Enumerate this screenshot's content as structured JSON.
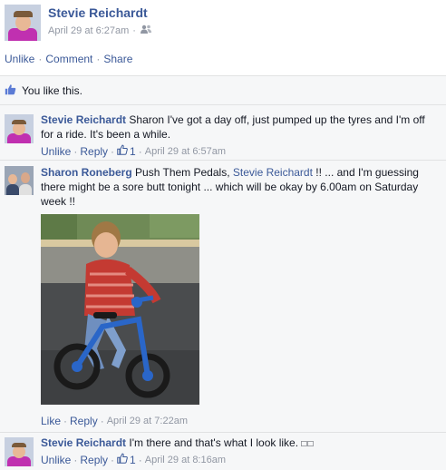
{
  "post": {
    "author": "Stevie Reichardt",
    "timestamp": "April 29 at 6:27am",
    "audience_icon": "friends-icon",
    "actions": {
      "unlike": "Unlike",
      "comment": "Comment",
      "share": "Share",
      "sep": "·"
    }
  },
  "likes": {
    "text": "You like this.",
    "icon": "thumbs-up-icon"
  },
  "comments": [
    {
      "author": "Stevie Reichardt",
      "text": "Sharon I've got a day off, just pumped up the tyres and I'm off for a ride. It's been a while.",
      "actions": {
        "primary": "Unlike",
        "reply": "Reply",
        "like_count": "1",
        "timestamp": "April 29 at 6:57am"
      }
    },
    {
      "author": "Sharon Roneberg",
      "text_before": "Push Them Pedals,",
      "mention": "Stevie Reichardt",
      "text_after": "!! ... and I'm guessing there might be a sore butt tonight ... which will be okay by 6.00am on Saturday week !!",
      "actions": {
        "primary": "Like",
        "reply": "Reply",
        "timestamp": "April 29 at 7:22am"
      }
    },
    {
      "author": "Stevie Reichardt",
      "text": "I'm there and that's what I look like.",
      "trailing_glyphs": "□□",
      "actions": {
        "primary": "Unlike",
        "reply": "Reply",
        "like_count": "1",
        "timestamp": "April 29 at 8:16am"
      }
    }
  ],
  "colors": {
    "link": "#3b5998",
    "meta": "#9197a3",
    "ufi_bg": "#f6f7f8",
    "divider": "#e1e2e3"
  }
}
